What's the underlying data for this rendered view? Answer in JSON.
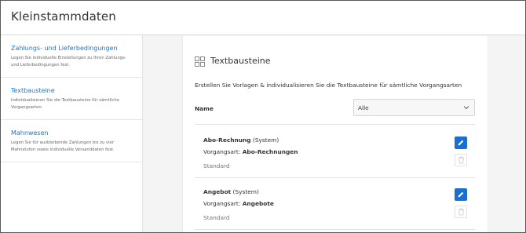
{
  "header": {
    "title": "Kleinstammdaten"
  },
  "sidebar": {
    "items": [
      {
        "title": "Zahlungs- und Lieferbedingungen",
        "desc": "Legen Sie individuelle Einstellungen zu Ihren Zahlungs- und Lieferbedingungen fest.",
        "active": false
      },
      {
        "title": "Textbausteine",
        "desc": "Individualisieren Sie die Textbausteine für sämtliche Vorgangsarten.",
        "active": true
      },
      {
        "title": "Mahnwesen",
        "desc": "Legen Sie für ausbleibende Zahlungen bis zu vier Mahnstufen sowie individuelle Versanddaten fest.",
        "active": false
      }
    ]
  },
  "card": {
    "title": "Textbausteine",
    "icon": "grid-icon",
    "description": "Erstellen Sie Vorlagen & individualisieren Sie die Textbausteine für sämtliche Vorgangsarten",
    "filter": {
      "label": "Name",
      "value": "Alle"
    }
  },
  "templates": [
    {
      "name": "Abo-Rechnung",
      "suffix": "(System)",
      "art_label": "Vorgangsart:",
      "art_value": "Abo-Rechnungen",
      "status": "Standard"
    },
    {
      "name": "Angebot",
      "suffix": "(System)",
      "art_label": "Vorgangsart:",
      "art_value": "Angebote",
      "status": "Standard"
    }
  ],
  "colors": {
    "accent": "#1e78c8",
    "button": "#1a6fd1"
  }
}
